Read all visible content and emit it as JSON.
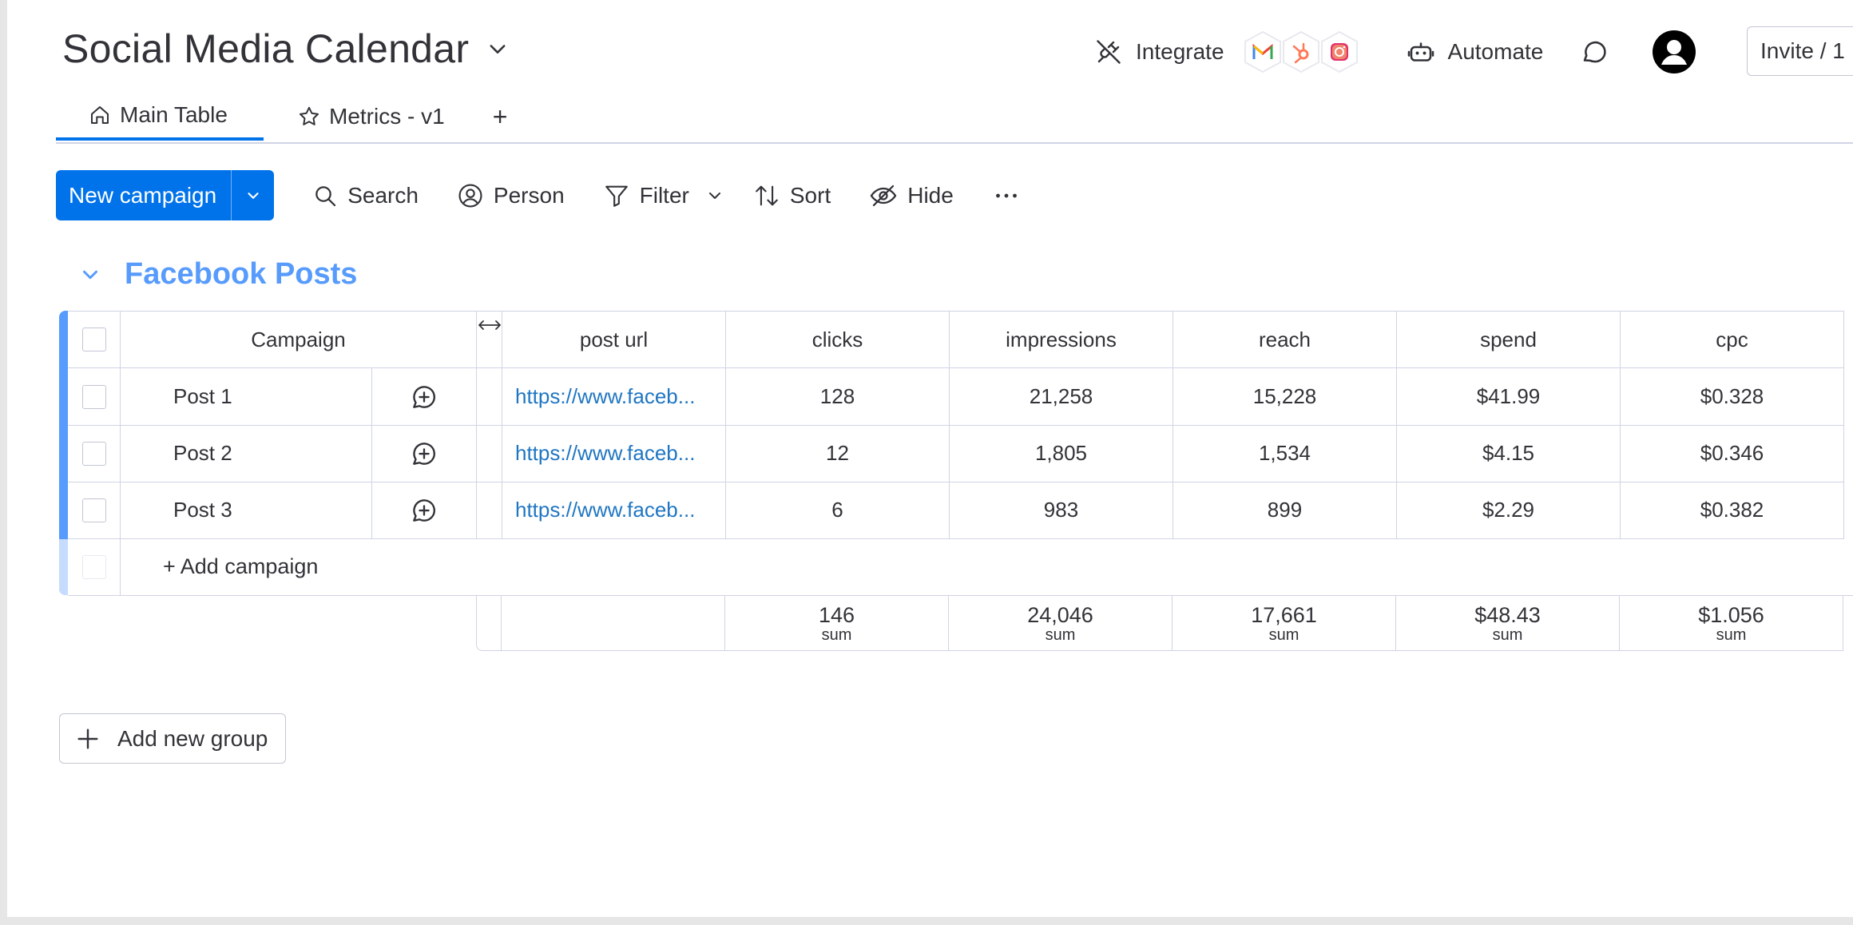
{
  "board": {
    "title": "Social Media Calendar"
  },
  "header": {
    "integrate_label": "Integrate",
    "automate_label": "Automate",
    "invite_label": "Invite / 1",
    "integration_apps": [
      "gmail",
      "hubspot",
      "instagram"
    ]
  },
  "tabs": [
    {
      "label": "Main Table",
      "icon": "home-icon",
      "active": true
    },
    {
      "label": "Metrics - v1",
      "icon": "star-icon",
      "active": false
    }
  ],
  "tab_add_label": "+",
  "toolbar": {
    "new_label": "New campaign",
    "search_label": "Search",
    "person_label": "Person",
    "filter_label": "Filter",
    "sort_label": "Sort",
    "hide_label": "Hide"
  },
  "group": {
    "title": "Facebook Posts",
    "color": "#579bfc",
    "columns": [
      "Campaign",
      "post url",
      "clicks",
      "impressions",
      "reach",
      "spend",
      "cpc"
    ],
    "rows": [
      {
        "name": "Post 1",
        "url": "https://www.faceb...",
        "clicks": "128",
        "impressions": "21,258",
        "reach": "15,228",
        "spend": "$41.99",
        "cpc": "$0.328"
      },
      {
        "name": "Post 2",
        "url": "https://www.faceb...",
        "clicks": "12",
        "impressions": "1,805",
        "reach": "1,534",
        "spend": "$4.15",
        "cpc": "$0.346"
      },
      {
        "name": "Post 3",
        "url": "https://www.faceb...",
        "clicks": "6",
        "impressions": "983",
        "reach": "899",
        "spend": "$2.29",
        "cpc": "$0.382"
      }
    ],
    "add_row_label": "+ Add campaign",
    "summary": {
      "clicks": "146",
      "impressions": "24,046",
      "reach": "17,661",
      "spend": "$48.43",
      "cpc": "$1.056",
      "label": "sum"
    }
  },
  "add_group_label": "Add new group",
  "colors": {
    "accent": "#0073ea",
    "group": "#579bfc",
    "link": "#1f76c2"
  }
}
